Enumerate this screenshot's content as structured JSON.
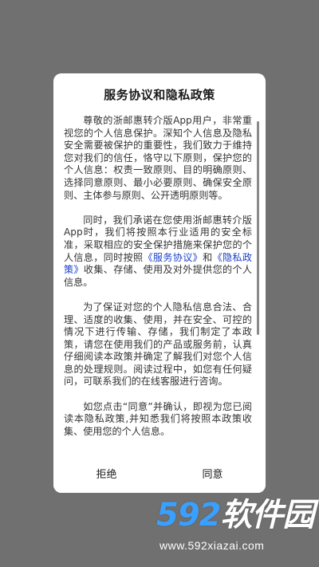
{
  "dialog": {
    "title": "服务协议和隐私政策",
    "paragraphs": {
      "p1": "尊敬的浙邮惠转介版App用户，非常重视您的个人信息保护。深知个人信息及隐私安全需要被保护的重要性，我们致力于维持您对我们的信任，恪守以下原则，保护您的个人信息：权责一致原则、目的明确原则、选择同意原则、最小必要原则、确保安全原则、主体参与原则、公开透明原则等。",
      "p2_before": "同时，我们承诺在您使用浙邮惠转介版App时，我们将按照本行业适用的安全标准，采取相应的安全保护措施来保护您的个人信息，同时按照",
      "p2_link1": "《服务协议》",
      "p2_mid": "和",
      "p2_link2": "《隐私政策》",
      "p2_after": "收集、存储、使用及对外提供您的个人信息。",
      "p3": "为了保证对您的个人隐私信息合法、合理、适度的收集、使用，并在安全、可控的情况下进行传输、存储，我们制定了本政策，请您在使用我们的产品或服务前，认真仔细阅读本政策并确定了解我们对您个人信息的处理规则。阅读过程中，如您有任何疑问，可联系我们的在线客服进行咨询。",
      "p4": "如您点击“同意”并确认，即视为您已阅读本隐私政策,并知悉我们将按照本政策收集、使用您的个人信息。"
    },
    "buttons": {
      "reject": "拒绝",
      "agree": "同意"
    }
  },
  "watermark": {
    "number": "592",
    "name": "软件园",
    "url": "www.592xiazai.com"
  },
  "colors": {
    "overlay": "#707070",
    "link": "#1a3fc9",
    "watermark_number": "#3aa0ff"
  }
}
